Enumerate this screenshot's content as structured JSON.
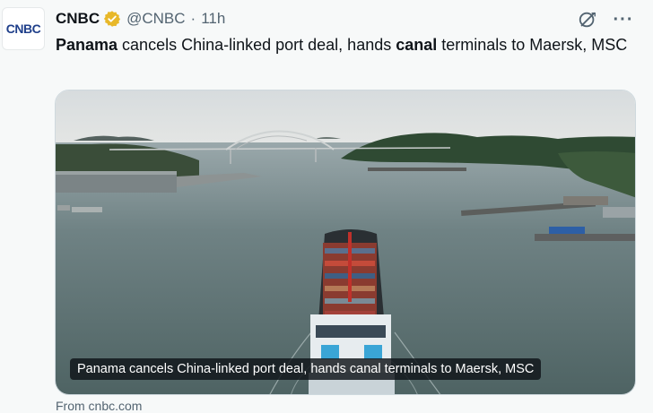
{
  "tweet": {
    "avatar_text": "CNBC",
    "author_name": "CNBC",
    "handle": "@CNBC",
    "separator": "·",
    "time": "11h",
    "text_parts": [
      {
        "text": "Panama",
        "bold": true
      },
      {
        "text": " cancels China-linked port deal, hands ",
        "bold": false
      },
      {
        "text": "canal",
        "bold": true
      },
      {
        "text": " terminals to Maersk, MSC",
        "bold": false
      }
    ],
    "media_caption": "Panama cancels China-linked port deal, hands canal terminals to Maersk, MSC",
    "below_media_cutoff": "From cnbc.com"
  },
  "icons": {
    "verified": "verified-badge-icon",
    "grok": "grok-icon",
    "more": "more-icon"
  },
  "colors": {
    "verified_gold": "#e8b829",
    "secondary_text": "#536471",
    "background": "#f7f9f9"
  }
}
